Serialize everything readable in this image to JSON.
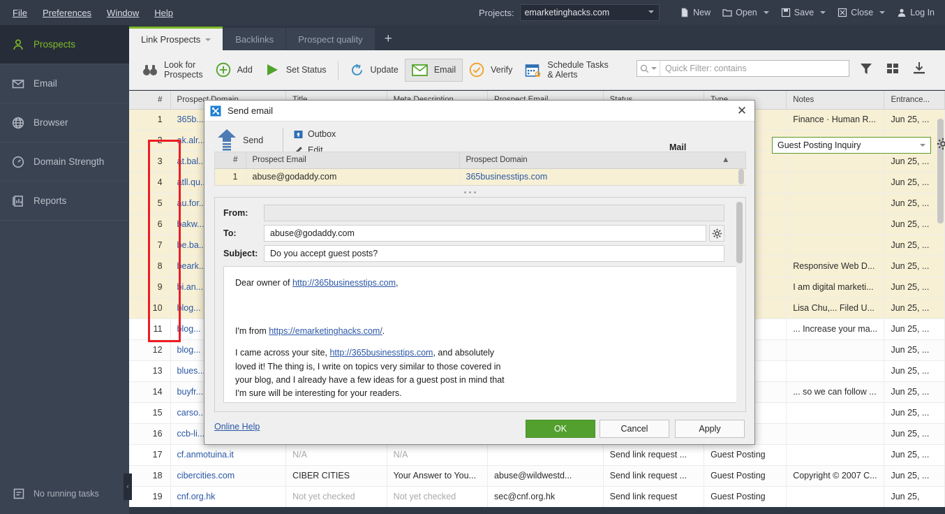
{
  "menu": {
    "items": [
      "File",
      "Preferences",
      "Window",
      "Help"
    ]
  },
  "project": {
    "label": "Projects:",
    "selected": "emarketinghacks.com"
  },
  "window_buttons": [
    {
      "label": "New",
      "icon": "new-file-icon",
      "has_caret": false
    },
    {
      "label": "Open",
      "icon": "folder-icon",
      "has_caret": true
    },
    {
      "label": "Save",
      "icon": "floppy-icon",
      "has_caret": true
    },
    {
      "label": "Close",
      "icon": "close-box-icon",
      "has_caret": true
    },
    {
      "label": "Log In",
      "icon": "user-icon",
      "has_caret": false
    }
  ],
  "sidebar": {
    "items": [
      {
        "label": "Prospects",
        "icon": "person-icon",
        "active": true
      },
      {
        "label": "Email",
        "icon": "envelope-icon",
        "active": false
      },
      {
        "label": "Browser",
        "icon": "globe-icon",
        "active": false
      },
      {
        "label": "Domain Strength",
        "icon": "gauge-icon",
        "active": false
      },
      {
        "label": "Reports",
        "icon": "report-icon",
        "active": false
      }
    ],
    "status": {
      "label": "No running tasks",
      "icon": "task-list-icon"
    }
  },
  "tabs": [
    {
      "label": "Link Prospects",
      "active": true,
      "has_caret": true
    },
    {
      "label": "Backlinks",
      "active": false,
      "has_caret": false
    },
    {
      "label": "Prospect quality",
      "active": false,
      "has_caret": false
    }
  ],
  "tab_add_label": "+",
  "toolbar": {
    "look_for_prospects": "Look for\nProspects",
    "look_line1": "Look for",
    "look_line2": "Prospects",
    "add": "Add",
    "set_status": "Set Status",
    "update": "Update",
    "email": "Email",
    "verify": "Verify",
    "schedule_line1": "Schedule Tasks",
    "schedule_line2": "& Alerts",
    "quick_filter_placeholder": "Quick Filter: contains",
    "quick_filter_value": ""
  },
  "table": {
    "columns": [
      "#",
      "Prospect Domain",
      "Title",
      "Meta Description",
      "Prospect Email",
      "Status",
      "Type",
      "Notes",
      "Entrance..."
    ],
    "rows": [
      {
        "n": "1",
        "domain": "365b...",
        "title": "",
        "meta": "",
        "email": "",
        "status": "",
        "type": "",
        "notes": "Finance · Human R...",
        "entrance": "Jun 25, ...",
        "sel": true
      },
      {
        "n": "2",
        "domain": "ak.alr...",
        "title": "",
        "meta": "",
        "email": "",
        "status": "",
        "type": "",
        "notes": "",
        "entrance": "Jun 25, ...",
        "sel": true
      },
      {
        "n": "3",
        "domain": "at.bal...",
        "title": "",
        "meta": "",
        "email": "",
        "status": "",
        "type": "",
        "notes": "",
        "entrance": "Jun 25, ...",
        "sel": true
      },
      {
        "n": "4",
        "domain": "atll.qu...",
        "title": "",
        "meta": "",
        "email": "",
        "status": "",
        "type": "",
        "notes": "",
        "entrance": "Jun 25, ...",
        "sel": true
      },
      {
        "n": "5",
        "domain": "au.for...",
        "title": "",
        "meta": "",
        "email": "",
        "status": "",
        "type": "",
        "notes": "",
        "entrance": "Jun 25, ...",
        "sel": true
      },
      {
        "n": "6",
        "domain": "bakw...",
        "title": "",
        "meta": "",
        "email": "",
        "status": "",
        "type": "",
        "notes": "",
        "entrance": "Jun 25, ...",
        "sel": true
      },
      {
        "n": "7",
        "domain": "be.ba...",
        "title": "",
        "meta": "",
        "email": "",
        "status": "",
        "type": "",
        "notes": "",
        "entrance": "Jun 25, ...",
        "sel": true
      },
      {
        "n": "8",
        "domain": "beark...",
        "title": "",
        "meta": "",
        "email": "",
        "status": "",
        "type": "",
        "notes": "Responsive Web D...",
        "entrance": "Jun 25, ...",
        "sel": true
      },
      {
        "n": "9",
        "domain": "bi.an...",
        "title": "",
        "meta": "",
        "email": "",
        "status": "",
        "type": "",
        "notes": "I am digital marketi...",
        "entrance": "Jun 25, ...",
        "sel": true
      },
      {
        "n": "10",
        "domain": "blog...",
        "title": "",
        "meta": "",
        "email": "",
        "status": "",
        "type": "",
        "notes": "Lisa Chu,... Filed U...",
        "entrance": "Jun 25, ...",
        "sel": true
      },
      {
        "n": "11",
        "domain": "blog...",
        "title": "",
        "meta": "",
        "email": "",
        "status": "",
        "type": "",
        "notes": "... Increase your ma...",
        "entrance": "Jun 25, ...",
        "sel": false
      },
      {
        "n": "12",
        "domain": "blog...",
        "title": "",
        "meta": "",
        "email": "",
        "status": "",
        "type": "",
        "notes": "",
        "entrance": "Jun 25, ...",
        "sel": false
      },
      {
        "n": "13",
        "domain": "blues...",
        "title": "",
        "meta": "",
        "email": "",
        "status": "",
        "type": "",
        "notes": "",
        "entrance": "Jun 25, ...",
        "sel": false
      },
      {
        "n": "14",
        "domain": "buyfr...",
        "title": "",
        "meta": "",
        "email": "",
        "status": "",
        "type": "",
        "notes": "... so we can follow ...",
        "entrance": "Jun 25, ...",
        "sel": false
      },
      {
        "n": "15",
        "domain": "carso...",
        "title": "",
        "meta": "",
        "email": "",
        "status": "",
        "type": "",
        "notes": "",
        "entrance": "Jun 25, ...",
        "sel": false
      },
      {
        "n": "16",
        "domain": "ccb-li...",
        "title": "",
        "meta": "",
        "email": "",
        "status": "",
        "type": "",
        "notes": "",
        "entrance": "Jun 25, ...",
        "sel": false
      },
      {
        "n": "17",
        "domain": "cf.anmotuina.it",
        "title": "N/A",
        "meta": "N/A",
        "email": "",
        "status": "Send link request ...",
        "type": "Guest Posting",
        "notes": "",
        "entrance": "Jun 25, ...",
        "sel": false
      },
      {
        "n": "18",
        "domain": "cibercities.com",
        "title": "CIBER CITIES",
        "meta": "Your Answer to You...",
        "email": "abuse@wildwestd...",
        "status": "Send link request ...",
        "type": "Guest Posting",
        "notes": "Copyright © 2007 C...",
        "entrance": "Jun 25, ...",
        "sel": false
      },
      {
        "n": "19",
        "domain": "cnf.org.hk",
        "title": "Not yet checked",
        "meta": "Not yet checked",
        "email": "sec@cnf.org.hk",
        "status": "Send link request",
        "type": "Guest Posting",
        "notes": "",
        "entrance": "Jun 25,",
        "sel": false
      }
    ]
  },
  "dialog": {
    "title": "Send email",
    "icon": "send-email-icon",
    "close_label": "✕",
    "send_label": "Send",
    "outbox_label": "Outbox",
    "edit_label": "Edit",
    "template_label": "Mail template",
    "template_value": "Guest Posting Inquiry",
    "template_gear": "gear-icon",
    "mini_grid": {
      "columns": [
        "#",
        "Prospect Email",
        "Prospect Domain"
      ],
      "rows": [
        {
          "n": "1",
          "email": "abuse@godaddy.com",
          "domain": "365businesstips.com"
        }
      ]
    },
    "form": {
      "from_label": "From:",
      "from_value": "",
      "to_label": "To:",
      "to_value": "abuse@godaddy.com",
      "subject_label": "Subject:",
      "subject_value": "Do you accept guest posts?"
    },
    "body": {
      "p1_pre": "Dear owner of ",
      "p1_link": "http://365businesstips.com",
      "p1_post": ",",
      "p2_pre": "I'm  from ",
      "p2_link": "https://emarketinghacks.com/",
      "p2_post": ".",
      "p3_pre": "I came across your site, ",
      "p3_link": "http://365businesstips.com",
      "p3_post": ", and absolutely loved it! The thing is, I write on topics very similar to those covered in your blog, and I already have a few ideas for a guest post in mind that I'm sure will be interesting for your readers."
    },
    "footer": {
      "online_help": "Online Help",
      "ok": "OK",
      "cancel": "Cancel",
      "apply": "Apply"
    }
  },
  "colors": {
    "accent_green": "#7fba28",
    "ok_green": "#53a02f",
    "highlight_red": "#ed1c24",
    "link_blue": "#2b57a6",
    "selected_row": "#f7f0d4",
    "chrome_dark": "#3a4351"
  },
  "panel_collapse_label": "‹"
}
